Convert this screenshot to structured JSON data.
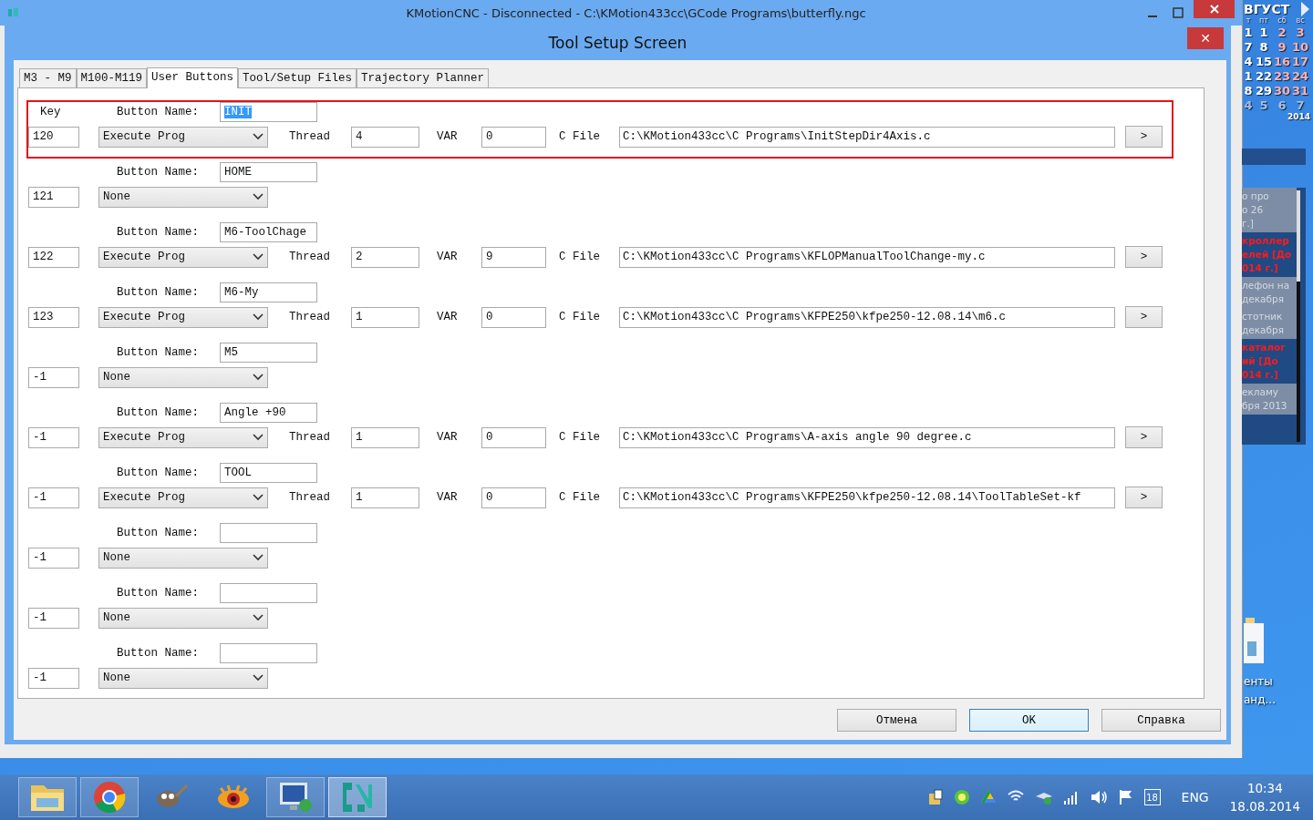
{
  "background_window": {
    "title": "KMotionCNC - Disconnected - C:\\KMotion433cc\\GCode Programs\\butterfly.ngc"
  },
  "dialog": {
    "title": "Tool Setup Screen",
    "close": "✕"
  },
  "tabs": [
    {
      "label": "M3 - M9",
      "selected": false
    },
    {
      "label": "M100-M119",
      "selected": false
    },
    {
      "label": "User Buttons",
      "selected": true
    },
    {
      "label": "Tool/Setup Files",
      "selected": false
    },
    {
      "label": "Trajectory Planner",
      "selected": false
    }
  ],
  "key_header": "Key",
  "rows": [
    {
      "selected": true,
      "name_label": "Button Name:",
      "name": "INIT",
      "name_highlighted": true,
      "key": "120",
      "action": "Execute Prog",
      "thread_label": "Thread",
      "thread": "4",
      "var_label": "VAR",
      "var": "0",
      "file_label": "C File",
      "file": "C:\\KMotion433cc\\C Programs\\InitStepDir4Axis.c",
      "browse": ">"
    },
    {
      "selected": false,
      "name_label": "Button Name:",
      "name": "HOME",
      "name_highlighted": false,
      "key": "121",
      "action": "None"
    },
    {
      "selected": false,
      "name_label": "Button Name:",
      "name": "M6-ToolChage",
      "name_highlighted": false,
      "key": "122",
      "action": "Execute Prog",
      "thread_label": "Thread",
      "thread": "2",
      "var_label": "VAR",
      "var": "9",
      "file_label": "C File",
      "file": "C:\\KMotion433cc\\C Programs\\KFLOPManualToolChange-my.c",
      "browse": ">"
    },
    {
      "selected": false,
      "name_label": "Button Name:",
      "name": "M6-My",
      "name_highlighted": false,
      "key": "123",
      "action": "Execute Prog",
      "thread_label": "Thread",
      "thread": "1",
      "var_label": "VAR",
      "var": "0",
      "file_label": "C File",
      "file": "C:\\KMotion433cc\\C Programs\\KFPE250\\kfpe250-12.08.14\\m6.c",
      "browse": ">"
    },
    {
      "selected": false,
      "name_label": "Button Name:",
      "name": "M5",
      "name_highlighted": false,
      "key": "-1",
      "action": "None"
    },
    {
      "selected": false,
      "name_label": "Button Name:",
      "name": "Angle +90",
      "name_highlighted": false,
      "key": "-1",
      "action": "Execute Prog",
      "thread_label": "Thread",
      "thread": "1",
      "var_label": "VAR",
      "var": "0",
      "file_label": "C File",
      "file": "C:\\KMotion433cc\\C Programs\\A-axis angle 90 degree.c",
      "browse": ">"
    },
    {
      "selected": false,
      "name_label": "Button Name:",
      "name": "TOOL",
      "name_highlighted": false,
      "key": "-1",
      "action": "Execute Prog",
      "thread_label": "Thread",
      "thread": "1",
      "var_label": "VAR",
      "var": "0",
      "file_label": "C File",
      "file": "C:\\KMotion433cc\\C Programs\\KFPE250\\kfpe250-12.08.14\\ToolTableSet-kf",
      "browse": ">"
    },
    {
      "selected": false,
      "name_label": "Button Name:",
      "key": "-1",
      "action": "None"
    },
    {
      "selected": false,
      "name_label": "Button Name:",
      "key": "-1",
      "action": "None"
    },
    {
      "selected": false,
      "name_label": "Button Name:",
      "key": "-1",
      "action": "None"
    }
  ],
  "buttons": [
    {
      "label": "Отмена",
      "default": false
    },
    {
      "label": "OK",
      "default": true
    },
    {
      "label": "Справка",
      "default": false
    }
  ],
  "calendar": {
    "month": "ВГУСТ",
    "weekdays": [
      "т",
      "пт",
      "сб",
      "вс"
    ],
    "weeks": [
      [
        "1",
        "1",
        "2",
        "3"
      ],
      [
        "7",
        "8",
        "9",
        "10"
      ],
      [
        "4",
        "15",
        "16",
        "17"
      ],
      [
        "1",
        "22",
        "23",
        "24"
      ],
      [
        "8",
        "29",
        "30",
        "31"
      ],
      [
        "4",
        "5",
        "6",
        "7"
      ]
    ],
    "year": "2014"
  },
  "news": [
    {
      "lines": [
        "о про",
        "о 26",
        "г.]"
      ],
      "urgent": false
    },
    {
      "lines": [
        "кроллер",
        "елей [До",
        "014 г.]"
      ],
      "urgent": true
    },
    {
      "lines": [
        "лефон на",
        "декабря"
      ],
      "urgent": false
    },
    {
      "lines": [
        "стотник",
        "декабря"
      ],
      "urgent": false
    },
    {
      "lines": [
        "каталог",
        "ий [До",
        "014 г.]"
      ],
      "urgent": true
    },
    {
      "lines": [
        "екламу",
        "бря 2013"
      ],
      "urgent": false
    }
  ],
  "desktop_icon": {
    "label_lines": [
      "енты",
      "анд..."
    ]
  },
  "taskbar": {
    "apps": [
      {
        "kind": "folder",
        "running": true,
        "active": false
      },
      {
        "kind": "browser",
        "running": true,
        "active": false
      },
      {
        "kind": "animal",
        "running": false,
        "active": false
      },
      {
        "kind": "eye",
        "running": false,
        "active": false
      },
      {
        "kind": "monitor",
        "running": true,
        "active": false
      },
      {
        "kind": "cnc",
        "running": true,
        "active": true
      }
    ],
    "tray": {
      "calendar_day": "18",
      "language": "ENG",
      "time": "10:34",
      "date": "18.08.2014"
    }
  }
}
